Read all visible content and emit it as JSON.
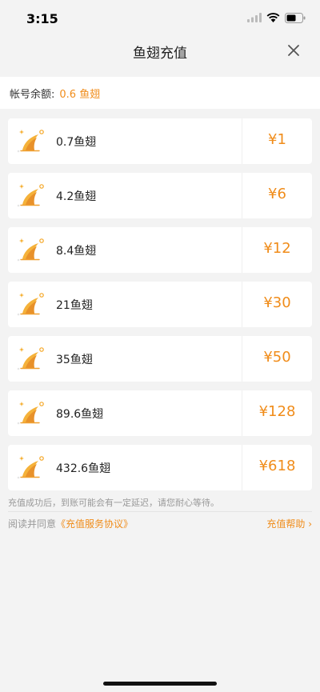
{
  "status": {
    "time": "3:15"
  },
  "header": {
    "title": "鱼翅充值"
  },
  "balance": {
    "label": "帐号余额:",
    "value": "0.6 鱼翅"
  },
  "packages": [
    {
      "amount": "0.7鱼翅",
      "price": "¥1"
    },
    {
      "amount": "4.2鱼翅",
      "price": "¥6"
    },
    {
      "amount": "8.4鱼翅",
      "price": "¥12"
    },
    {
      "amount": "21鱼翅",
      "price": "¥30"
    },
    {
      "amount": "35鱼翅",
      "price": "¥50"
    },
    {
      "amount": "89.6鱼翅",
      "price": "¥128"
    },
    {
      "amount": "432.6鱼翅",
      "price": "¥618"
    }
  ],
  "notice": "充值成功后，到账可能会有一定延迟，请您耐心等待。",
  "agreement": {
    "prefix": "阅读并同意",
    "link": "《充值服务协议》"
  },
  "help": {
    "label": "充值帮助 ›"
  },
  "colors": {
    "accent": "#f08c1a",
    "background": "#f3f3f3"
  },
  "icons": {
    "package": "shark-fin-icon",
    "close": "close-icon"
  }
}
